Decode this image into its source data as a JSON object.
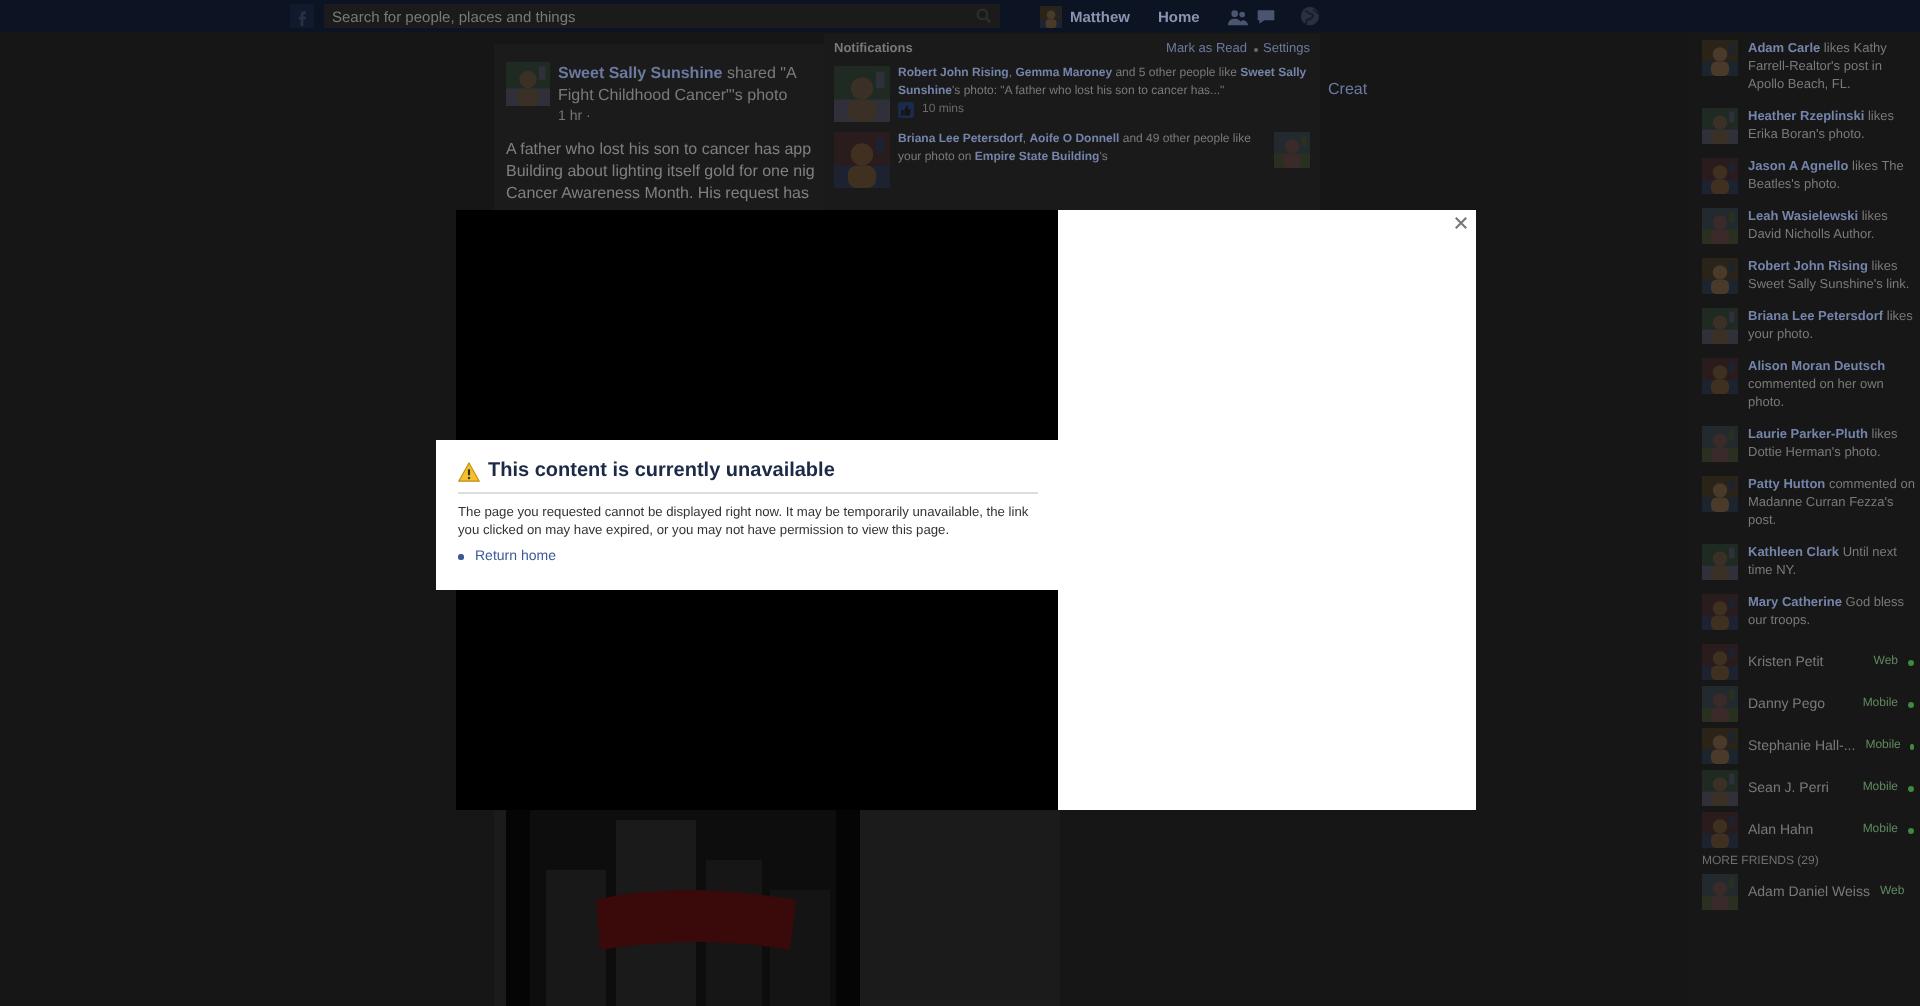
{
  "top_bar": {
    "search": {
      "placeholder": "Search for people, places and things"
    },
    "user_name": "Matthew",
    "home_link": "Home"
  },
  "post": {
    "author": "Sweet Sally Sunshine",
    "shared": "shared \"A",
    "headline_line_2": "Fight Childhood Cancer\"'s photo",
    "time": "1 hr ·",
    "body_lines": [
      "A father who lost his son to cancer has app",
      "Building about lighting itself gold for one nig",
      "Cancer Awareness Month. His request has"
    ]
  },
  "side_text": "Creat",
  "notifications": {
    "title": "Notifications",
    "actions": [
      "Mark as Read",
      "Settings"
    ],
    "items": [
      {
        "text": "**Robert John Rising**, **Gemma Maroney** and 5 other people like **Sweet Sally Sunshine**'s photo: \"A father who lost his son to cancer has...\"",
        "time": "10 mins"
      },
      {
        "text": "**Briana Lee Petersdorf**, **Aoife O Donnell** and 49 other people like your photo on **Empire State Building**'s"
      }
    ]
  },
  "dialog": {
    "title": "This content is currently unavailable",
    "message": "The page you requested cannot be displayed right now. It may be temporarily unavailable, the link you clicked on may have expired, or you may not have permission to view this page.",
    "links": [
      "Return home"
    ]
  },
  "ticker": [
    {
      "text": "**Adam Carle** likes Kathy Farrell-Realtor's post in Apollo Beach, FL."
    },
    {
      "text": "**Heather Rzeplinski** likes Erika Boran's photo."
    },
    {
      "text": "**Jason A Agnello** likes The Beatles's photo."
    },
    {
      "text": "**Leah Wasielewski** likes David Nicholls Author."
    },
    {
      "text": "**Robert John Rising** likes Sweet Sally Sunshine's link."
    },
    {
      "text": "**Briana Lee Petersdorf** likes your photo."
    },
    {
      "text": "**Alison Moran Deutsch** commented on her own photo."
    },
    {
      "text": "**Laurie Parker-Pluth** likes Dottie Herman's photo."
    },
    {
      "text": "**Patty Hutton** commented on Madanne Curran Fezza's post."
    },
    {
      "text": "**Kathleen Clark** Until next time NY."
    },
    {
      "text": "**Mary Catherine** God bless our troops."
    }
  ],
  "chat": {
    "online": [
      {
        "name": "Kristen Petit",
        "status": "Web"
      },
      {
        "name": "Danny Pego",
        "status": "Mobile"
      },
      {
        "name": "Stephanie Hall-...",
        "status": "Mobile"
      },
      {
        "name": "Sean J. Perri",
        "status": "Mobile"
      },
      {
        "name": "Alan Hahn",
        "status": "Mobile"
      }
    ],
    "section": "MORE FRIENDS (29)",
    "more": [
      {
        "name": "Adam Daniel Weiss",
        "status": "Web"
      }
    ]
  }
}
